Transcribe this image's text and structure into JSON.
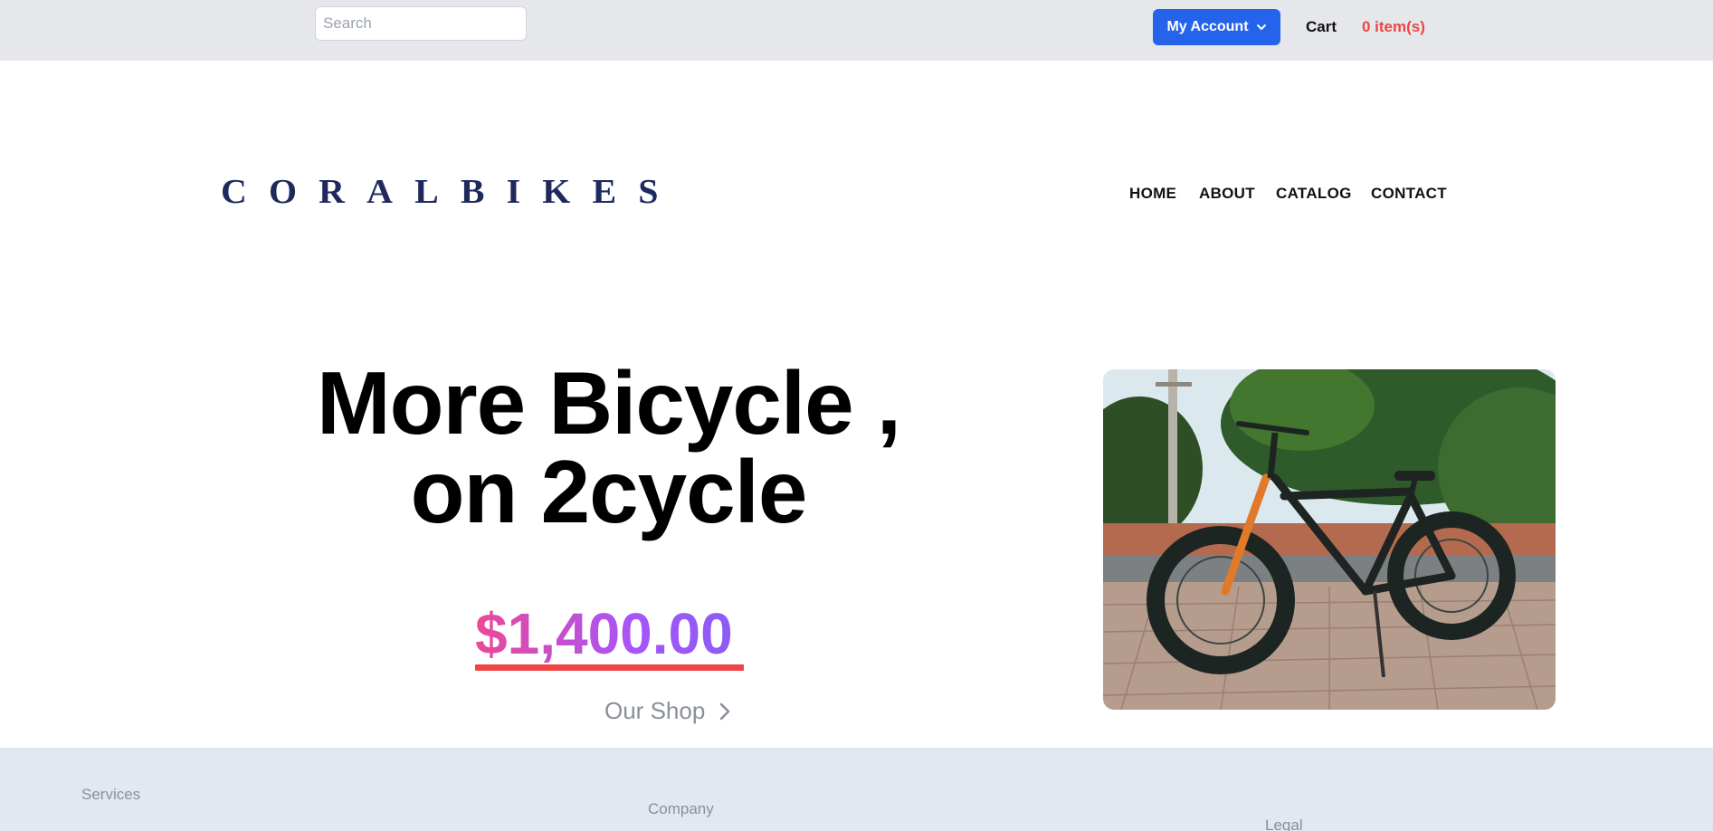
{
  "topbar": {
    "search_placeholder": "Search",
    "account_label": "My Account",
    "cart_label": "Cart",
    "cart_count": "0 item(s)"
  },
  "header": {
    "logo": "CORALBIKES",
    "nav": [
      "HOME",
      "ABOUT",
      "CATALOG",
      "CONTACT"
    ]
  },
  "hero": {
    "headline_line1": "More Bicycle ,",
    "headline_line2": "on 2cycle",
    "price": "$1,400.00",
    "shop_link": "Our Shop"
  },
  "footer": {
    "columns": [
      "Services",
      "Company",
      "Legal"
    ]
  },
  "colors": {
    "topbar_bg": "#e5e7eb",
    "account_button": "#2563eb",
    "cart_count": "#ef4444",
    "logo": "#1e2a5e",
    "price_gradient_start": "#ec4899",
    "price_gradient_end": "#8b5cf6",
    "price_underline": "#ef4444",
    "footer_bg": "#e2e8f0"
  }
}
